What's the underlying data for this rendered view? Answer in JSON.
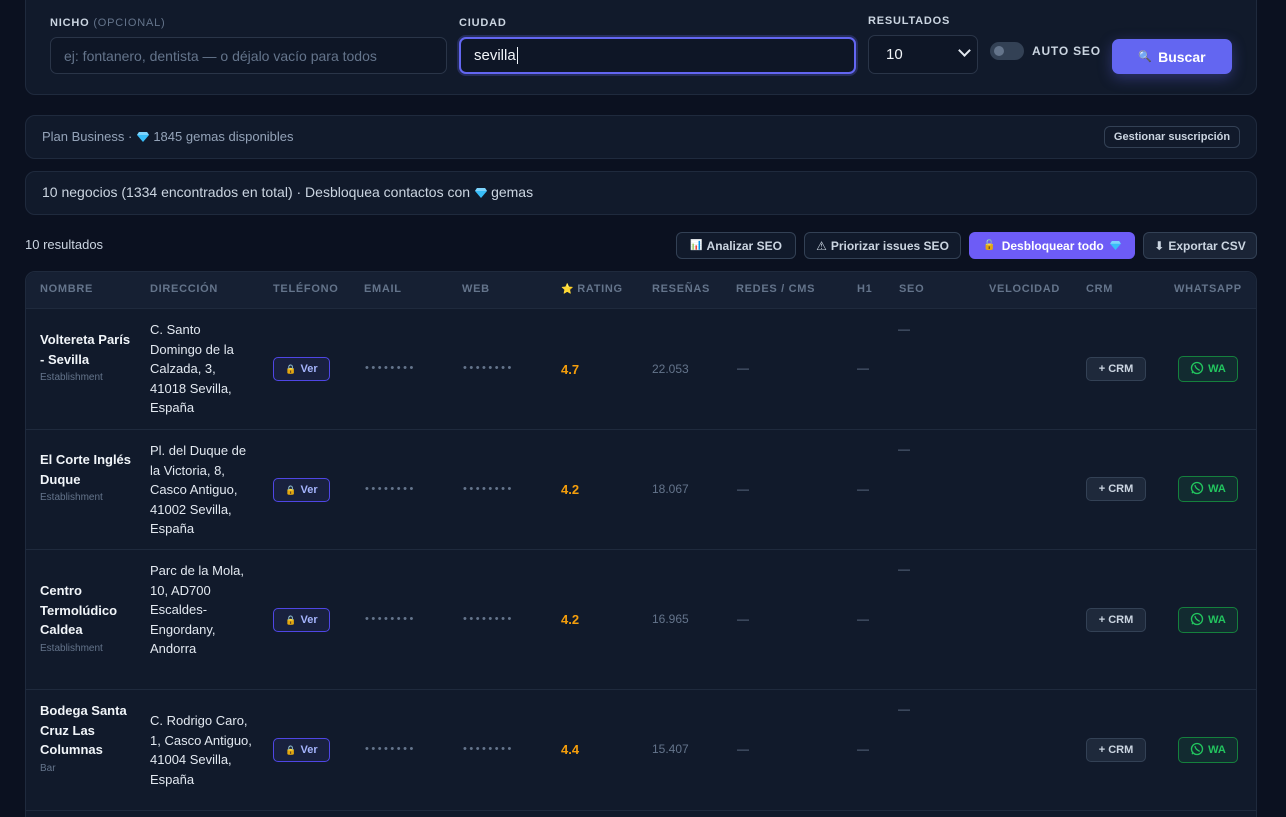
{
  "search": {
    "niche_label": "NICHO",
    "niche_optional": "(OPCIONAL)",
    "niche_placeholder": "ej: fontanero, dentista — o déjalo vacío para todos",
    "city_label": "CIUDAD",
    "city_value": "sevilla",
    "results_label": "RESULTADOS",
    "results_value": "10",
    "auto_seo_label": "AUTO SEO",
    "search_button": "Buscar",
    "search_icon": "🔍"
  },
  "plan": {
    "text_prefix": "Plan Business ·",
    "gems_text": "1845 gemas disponibles",
    "manage_button": "Gestionar suscripción"
  },
  "summary": {
    "text": "10 negocios (1334 encontrados en total) · Desbloquea contactos con",
    "gems_word": "gemas"
  },
  "toolbar": {
    "results_count": "10 resultados",
    "analyze_seo": "Analizar SEO",
    "analyze_icon": "📊",
    "prioritize_seo": "Priorizar issues SEO",
    "prioritize_icon": "⚠",
    "unlock_all": "Desbloquear todo",
    "unlock_icon": "🔓",
    "export_csv": "Exportar CSV",
    "export_icon": "⬇"
  },
  "table": {
    "headers": [
      "NOMBRE",
      "DIRECCIÓN",
      "TELÉFONO",
      "EMAIL",
      "WEB",
      "RATING",
      "RESEÑAS",
      "REDES / CMS",
      "H1",
      "SEO",
      "VELOCIDAD",
      "CRM",
      "WHATSAPP"
    ],
    "rating_icon": "⭐",
    "ver_label": "Ver",
    "lock_icon": "🔒",
    "masked": "••••••••",
    "dash": "—",
    "crm_label": "+ CRM",
    "wa_label": "WA",
    "rows": [
      {
        "name": "Voltereta París - Sevilla",
        "type": "Establishment",
        "address": "C. Santo Domingo de la Calzada, 3, 41018 Sevilla, España",
        "rating": "4.7",
        "reviews": "22.053"
      },
      {
        "name": "El Corte Inglés Duque",
        "type": "Establishment",
        "address": "Pl. del Duque de la Victoria, 8, Casco Antiguo, 41002 Sevilla, España",
        "rating": "4.2",
        "reviews": "18.067"
      },
      {
        "name": "Centro Termolúdico Caldea",
        "type": "Establishment",
        "address": "Parc de la Mola, 10, AD700 Escaldes-Engordany, Andorra",
        "rating": "4.2",
        "reviews": "16.965"
      },
      {
        "name": "Bodega Santa Cruz Las Columnas",
        "type": "Bar",
        "address": "C. Rodrigo Caro, 1, Casco Antiguo, 41004 Sevilla, España",
        "rating": "4.4",
        "reviews": "15.407"
      }
    ]
  },
  "colors": {
    "background": "#0b1120",
    "accent": "#6366f1",
    "rating": "#f59e0b",
    "whatsapp": "#22c55e"
  }
}
